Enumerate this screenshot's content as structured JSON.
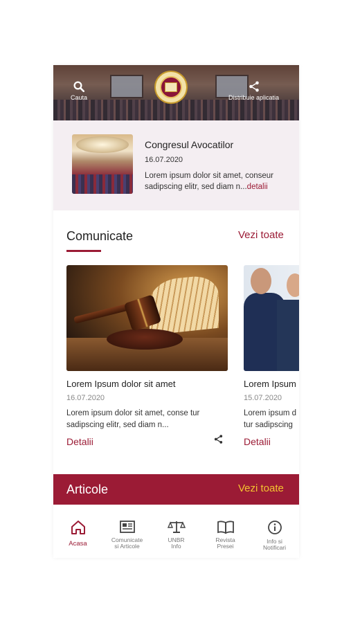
{
  "colors": {
    "accent": "#9b1b35",
    "link_on_dark": "#f4c430",
    "featured_bg": "#f4eef2"
  },
  "header": {
    "search_label": "Cauta",
    "share_label": "Distribuie aplicatia",
    "search_icon": "search-icon",
    "share_icon": "share-icon"
  },
  "featured": {
    "title": "Congresul Avocatilor",
    "date": "16.07.2020",
    "text": "Lorem ipsum dolor sit amet, conseur sadipscing elitr, sed diam n...",
    "more": "detalii"
  },
  "comunicate": {
    "title": "Comunicate",
    "see_all": "Vezi toate",
    "cards": [
      {
        "title": "Lorem Ipsum dolor sit amet",
        "date": "16.07.2020",
        "text": "Lorem ipsum dolor sit amet, conse tur sadipscing elitr, sed diam n...",
        "details": "Detalii"
      },
      {
        "title": "Lorem Ipsum",
        "date": "15.07.2020",
        "text": "Lorem ipsum d tur sadipscing",
        "details": "Detalii"
      }
    ]
  },
  "articole": {
    "title": "Articole",
    "see_all": "Vezi toate"
  },
  "nav": {
    "items": [
      {
        "label": "Acasa",
        "icon": "home-icon",
        "active": true
      },
      {
        "label": "Comunicate\nsi Articole",
        "icon": "news-icon",
        "active": false
      },
      {
        "label": "UNBR\nInfo",
        "icon": "scales-icon",
        "active": false
      },
      {
        "label": "Revista\nPresei",
        "icon": "book-icon",
        "active": false
      },
      {
        "label": "Info si\nNotificari",
        "icon": "info-icon",
        "active": false
      }
    ]
  }
}
